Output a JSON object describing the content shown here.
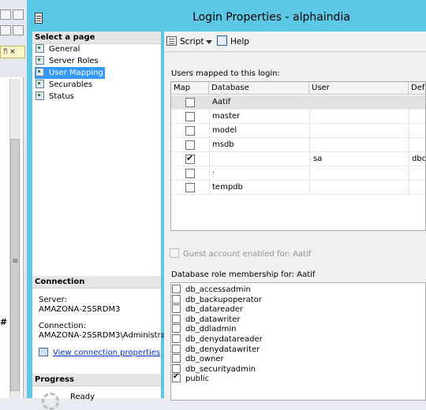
{
  "dialog": {
    "title": "Login Properties - alphaindia"
  },
  "left_pane": {
    "select_page_header": "Select a page",
    "pages": [
      {
        "label": "General"
      },
      {
        "label": "Server Roles"
      },
      {
        "label": "User Mapping",
        "selected": true
      },
      {
        "label": "Securables"
      },
      {
        "label": "Status"
      }
    ],
    "connection_header": "Connection",
    "server_label": "Server:",
    "server_value": "AMAZONA-2SSRDM3",
    "connection_label": "Connection:",
    "connection_value": "AMAZONA-2SSRDM3\\Administra",
    "view_connection_link": "View connection properties",
    "progress_header": "Progress",
    "progress_status": "Ready"
  },
  "toolbar": {
    "script_label": "Script",
    "help_label": "Help"
  },
  "user_mapping": {
    "label": "Users mapped to this login:",
    "columns": [
      "Map",
      "Database",
      "User",
      "Default"
    ],
    "columns_visible": [
      "Map",
      "Database",
      "User",
      "Defa"
    ],
    "rows": [
      {
        "map": false,
        "database": "Aatif",
        "user": "",
        "default_schema": ""
      },
      {
        "map": false,
        "database": "master",
        "user": "",
        "default_schema": ""
      },
      {
        "map": false,
        "database": "model",
        "user": "",
        "default_schema": ""
      },
      {
        "map": false,
        "database": "msdb",
        "user": "",
        "default_schema": ""
      },
      {
        "map": true,
        "database": "",
        "user": "sa",
        "default_schema": "dbo"
      },
      {
        "map": false,
        "database": "·",
        "user": "",
        "default_schema": ""
      },
      {
        "map": false,
        "database": "tempdb",
        "user": "",
        "default_schema": ""
      }
    ]
  },
  "guest": {
    "label": "Guest account enabled for: Aatif",
    "checked": false,
    "enabled": false
  },
  "roles": {
    "label": "Database role membership for: Aatif",
    "items": [
      {
        "name": "db_accessadmin",
        "checked": false
      },
      {
        "name": "db_backupoperator",
        "checked": false
      },
      {
        "name": "db_datareader",
        "checked": false
      },
      {
        "name": "db_datawriter",
        "checked": false
      },
      {
        "name": "db_ddladmin",
        "checked": false
      },
      {
        "name": "db_denydatareader",
        "checked": false
      },
      {
        "name": "db_denydatawriter",
        "checked": false
      },
      {
        "name": "db_owner",
        "checked": false
      },
      {
        "name": "db_securityadmin",
        "checked": false
      },
      {
        "name": "public",
        "checked": true
      }
    ]
  },
  "background": {
    "pin_tab": "ᛗ ×",
    "grip": "≡",
    "hash": "#"
  },
  "colors": {
    "title_bar": "#5cc8e6",
    "selection": "#3399ff",
    "link": "#0033cc"
  }
}
